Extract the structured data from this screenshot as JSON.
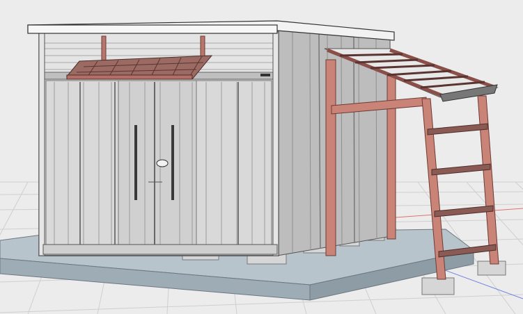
{
  "viewport": {
    "background": "#ececec",
    "grid_color": "#cfcfcf",
    "axis_red": "#e07070",
    "axis_blue": "#7080e0"
  },
  "scene": {
    "shed_body_color": "#d4d4d4",
    "shed_side_color": "#bdbdbd",
    "roof_color": "#f2f2f2",
    "slab_top_color": "#b8c4cc",
    "slab_side_color": "#9eacb6",
    "timber_color": "#c98477",
    "timber_dark": "#8a4f48",
    "awning_color": "#9b6a62",
    "block_color": "#d6d6d6"
  }
}
